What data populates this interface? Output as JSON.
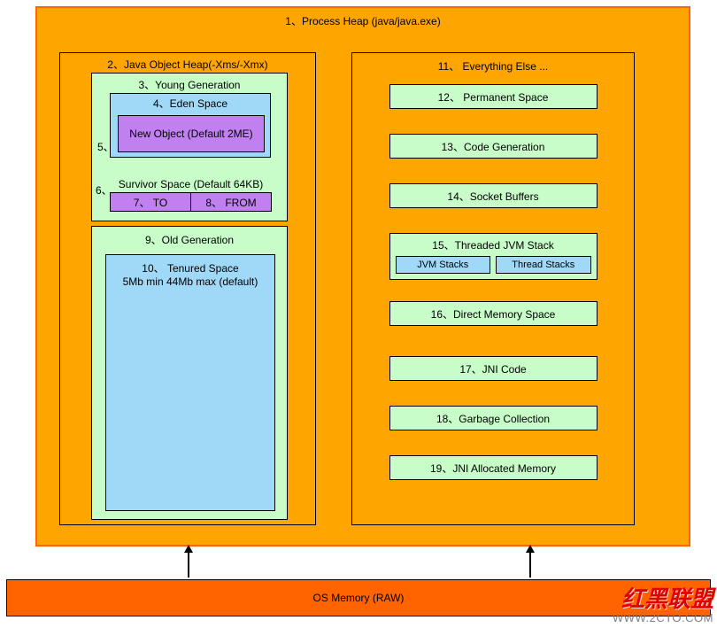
{
  "processHeap": "1、Process Heap (java/java.exe)",
  "javaObjectHeap": "2、Java Object Heap(-Xms/-Xmx)",
  "youngGen": "3、Young Generation",
  "edenSpace": "4、Eden Space",
  "label5": "5、",
  "newObject": "New Object (Default 2ME)",
  "label6": "6、",
  "survivorSpace": "Survivor Space (Default 64KB)",
  "to": "7、 TO",
  "from": "8、 FROM",
  "oldGen": "9、Old Generation",
  "tenured1": "10、 Tenured Space",
  "tenured2": "5Mb min 44Mb max (default)",
  "everythingElse": "11、 Everything Else ...",
  "permSpace": "12、 Permanent Space",
  "codeGen": "13、Code Generation",
  "socketBuffers": "14、Socket Buffers",
  "threadedJvm": "15、Threaded JVM Stack",
  "jvmStacks": "JVM Stacks",
  "threadStacks": "Thread Stacks",
  "directMem": "16、Direct Memory Space",
  "jniCode": "17、JNI Code",
  "gc": "18、Garbage Collection",
  "jniAlloc": "19、JNI Allocated Memory",
  "osMemory": "OS Memory (RAW)",
  "watermarkTop": "红黑联盟",
  "watermarkUrl": "WWW.2CTO.COM"
}
